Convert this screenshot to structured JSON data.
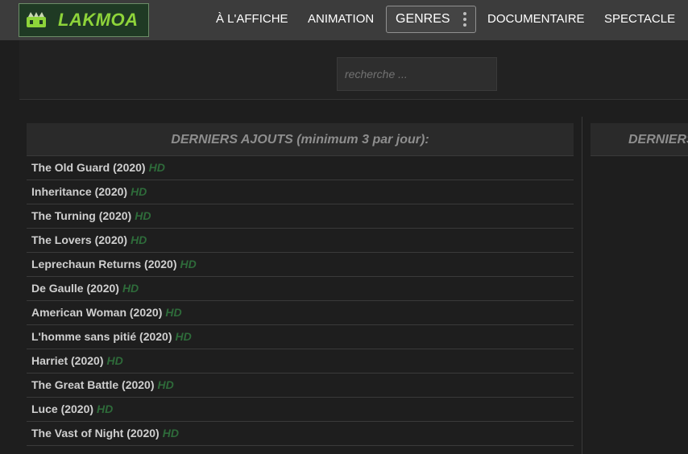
{
  "header": {
    "logo_text": "LAKMOA",
    "nav": {
      "a_laffiche": "À L'AFFICHE",
      "animation": "ANIMATION",
      "genres": "GENRES",
      "documentaire": "DOCUMENTAIRE",
      "spectacle": "SPECTACLE"
    }
  },
  "search": {
    "placeholder": "recherche ..."
  },
  "latest": {
    "title": "DERNIERS AJOUTS (minimum 3 par jour):",
    "right_title_partial": "DERNIERS",
    "quality_label": "HD",
    "items": [
      {
        "title": "The Old Guard (2020)",
        "quality": "HD"
      },
      {
        "title": "Inheritance (2020)",
        "quality": "HD"
      },
      {
        "title": "The Turning (2020)",
        "quality": "HD"
      },
      {
        "title": "The Lovers (2020)",
        "quality": "HD"
      },
      {
        "title": "Leprechaun Returns (2020)",
        "quality": "HD"
      },
      {
        "title": "De Gaulle (2020)",
        "quality": "HD"
      },
      {
        "title": "American Woman (2020)",
        "quality": "HD"
      },
      {
        "title": "L'homme sans pitié (2020)",
        "quality": "HD"
      },
      {
        "title": "Harriet (2020)",
        "quality": "HD"
      },
      {
        "title": "The Great Battle (2020)",
        "quality": "HD"
      },
      {
        "title": "Luce (2020)",
        "quality": "HD"
      },
      {
        "title": "The Vast of Night (2020)",
        "quality": "HD"
      }
    ]
  },
  "colors": {
    "logo_green": "#8ed43a",
    "hd_green": "#2e6b3a",
    "topbar": "#3c3c3c"
  }
}
